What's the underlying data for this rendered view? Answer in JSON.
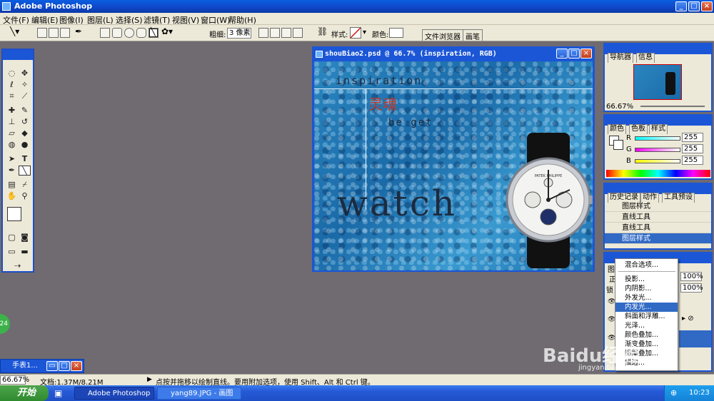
{
  "app": {
    "title": "Adobe Photoshop",
    "colors": {
      "titlebar": "#0f46c8",
      "panel_bg": "#ece9d8",
      "workspace": "#6f6b70",
      "highlight": "#316ac5"
    }
  },
  "menu": {
    "items": [
      "文件(F)",
      "编辑(E)",
      "图像(I)",
      "图层(L)",
      "选择(S)",
      "滤镜(T)",
      "视图(V)",
      "窗口(W)",
      "帮助(H)"
    ]
  },
  "options": {
    "weight_label": "粗细:",
    "weight_value": "3 像素",
    "style_label": "样式:",
    "color_label": "颜色:",
    "tab_file_browser": "文件浏览器",
    "tab_brushes": "画笔"
  },
  "document": {
    "title": "shouBiao2.psd @ 66.7% (inspiration, RGB)",
    "text_inspiration": "inspiration",
    "text_soul": "灵魂",
    "text_beget": "be get",
    "text_watch": "watch",
    "watch_dial_brand": "PATEK PHILIPPE"
  },
  "navigator": {
    "tabs": [
      "导航器",
      "信息"
    ],
    "zoom": "66.67%"
  },
  "color_panel": {
    "tabs": [
      "颜色",
      "色板",
      "样式"
    ],
    "channels": [
      {
        "label": "R",
        "value": "255"
      },
      {
        "label": "G",
        "value": "255"
      },
      {
        "label": "B",
        "value": "255"
      }
    ]
  },
  "history": {
    "tabs": [
      "历史记录",
      "动作",
      "工具预设"
    ],
    "items": [
      "图层样式",
      "直线工具",
      "直线工具",
      "图层样式"
    ]
  },
  "layers": {
    "opacity": "100%",
    "fill": "100%",
    "mode_abbrev": "正",
    "lock_abbrev": "锁"
  },
  "context_menu": {
    "items": [
      "混合选项...",
      "投影...",
      "内阴影...",
      "外发光...",
      "内发光...",
      "斜面和浮雕...",
      "光泽...",
      "颜色叠加...",
      "渐变叠加...",
      "图案叠加...",
      "描边..."
    ],
    "selected_index": 4
  },
  "statusbar": {
    "zoom": "66.67%",
    "doc_size": "文档:1.37M/8.21M",
    "hint": "点按并拖移以绘制直线。要用附加选项，使用 Shift、Alt 和 Ctrl 键。"
  },
  "minimized_doc": {
    "title": "手表1..."
  },
  "taskbar": {
    "start_label": "开始",
    "tasks": [
      "Adobe Photoshop",
      "yang89.JPG - 画图"
    ],
    "clock": "10:23"
  },
  "watermark": {
    "text": "Baidu经验",
    "sub": "jingyan.baidu.com"
  }
}
